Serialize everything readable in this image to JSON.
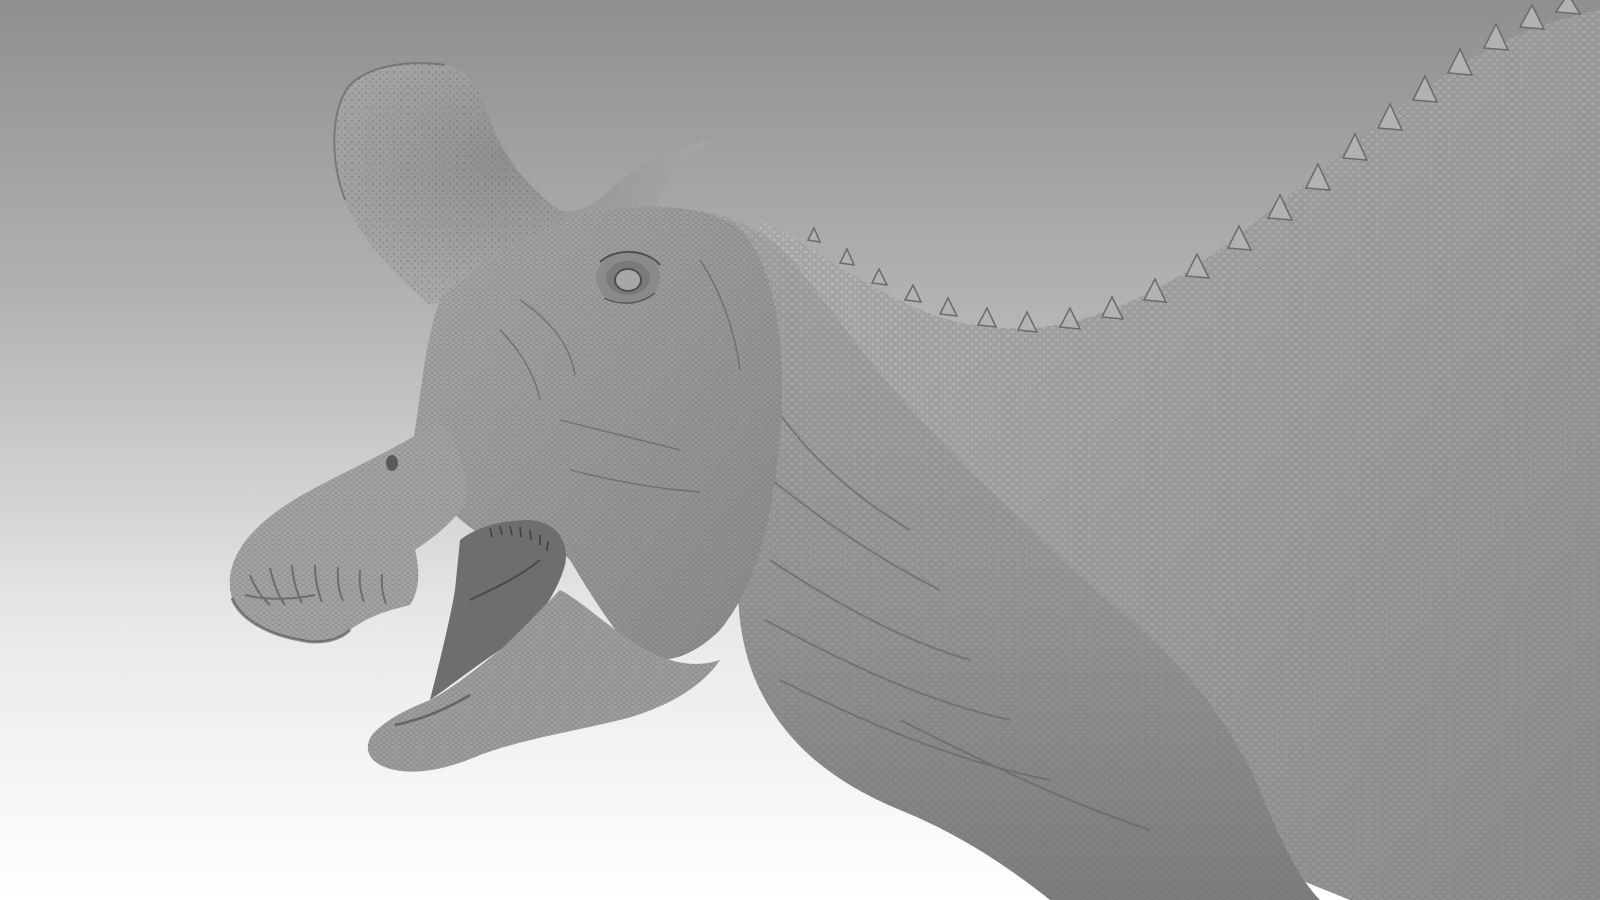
{
  "scene": {
    "subject": "dinosaur-sculpt",
    "background_gradient": [
      "#8f8f8f",
      "#b4b4b4",
      "#e9e9e9",
      "#ffffff"
    ],
    "sculpt_colors": {
      "base": "#9c9c9c",
      "light": "#bdbdbd",
      "mid": "#8a8a8a",
      "shadow": "#5a5a5a",
      "deep": "#3c3c3c"
    }
  }
}
